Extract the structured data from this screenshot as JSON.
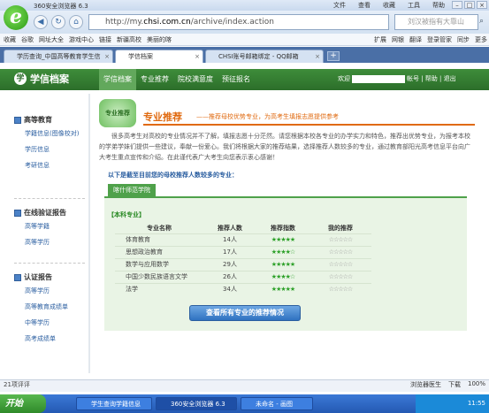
{
  "browser": {
    "app_title": "360安全浏览器 6.3",
    "menu": [
      "文件",
      "查看",
      "收藏",
      "工具",
      "帮助"
    ],
    "url_prefix": "http://my.",
    "url_host": "chsi.com.cn",
    "url_path": "/archive/index.action",
    "search_placeholder": "刘汉被指有大靠山",
    "favorites": [
      "收藏",
      "谷歌",
      "网址大全",
      "游戏中心",
      "链接",
      "新疆高校",
      "美丽的喀"
    ],
    "favorites_right": [
      "扩展",
      "网银",
      "翻译",
      "登录管家",
      "同步",
      "更多"
    ],
    "tabs": [
      {
        "label": "学历查询_中国高等教育学生信"
      },
      {
        "label": "学信档案"
      },
      {
        "label": "CHSI账号邮箱绑定 - QQ邮箱"
      }
    ]
  },
  "site": {
    "logo_text": "学信档案",
    "logo_mark": "学",
    "nav": [
      "学信档案",
      "专业推荐",
      "院校满意度",
      "预征报名"
    ],
    "welcome": "欢迎",
    "account_links": "帐号 | 帮助 | 退出"
  },
  "sidebar": {
    "groups": [
      {
        "title": "高等教育",
        "items": [
          "学籍信息(图像校对)",
          "学历信息",
          "考研信息"
        ]
      },
      {
        "title": "在线验证报告",
        "items": [
          "高等学籍",
          "高等学历"
        ]
      },
      {
        "title": "认证报告",
        "items": [
          "高等学历",
          "高等教育成绩单",
          "中等学历",
          "高考成绩单"
        ]
      }
    ]
  },
  "main": {
    "banner_img_text": "专业推荐",
    "title": "专业推荐",
    "subtitle": "——推荐母校优势专业，为高考生填报志愿提供参考",
    "intro": "很多高考生对高校的专业情况并不了解，填报志愿十分茫然。请您根据本校各专业的办学实力和特色，推荐出优势专业，为报考本校的学弟学妹们提供一些建议，奉献一份爱心。我们将根据大家的推荐结果，选择推荐人数较多的专业，通过教育部阳光高考信息平台向广大考生重点宣传和介绍。在此谨代表广大考生向您表示衷心感谢！",
    "list_heading": "以下是截至目前您的母校推荐人数较多的专业：",
    "school_tab": "喀什师范学院",
    "panel_label": "【本科专业】",
    "columns": [
      "专业名称",
      "推荐人数",
      "推荐指数",
      "我的推荐"
    ],
    "rows": [
      {
        "name": "体育教育",
        "count": "14人",
        "stars": "★★★★★",
        "mine": "☆☆☆☆☆"
      },
      {
        "name": "思想政治教育",
        "count": "17人",
        "stars": "★★★★☆",
        "mine": "☆☆☆☆☆"
      },
      {
        "name": "数学与应用数学",
        "count": "29人",
        "stars": "★★★★★",
        "mine": "☆☆☆☆☆"
      },
      {
        "name": "中国少数民族语言文学",
        "count": "26人",
        "stars": "★★★★☆",
        "mine": "☆☆☆☆☆"
      },
      {
        "name": "法学",
        "count": "34人",
        "stars": "★★★★★",
        "mine": "☆☆☆☆☆"
      }
    ],
    "view_all": "查看所有专业的推荐情况"
  },
  "statusbar": {
    "left": "21项评评",
    "right": [
      "浏览器医生",
      "下载",
      "100%"
    ]
  },
  "taskbar": {
    "start": "开始",
    "tasks": [
      "学生查询学籍信息",
      "360安全浏览器 6.3",
      "未命名 - 画图"
    ],
    "clock": "11:55"
  }
}
